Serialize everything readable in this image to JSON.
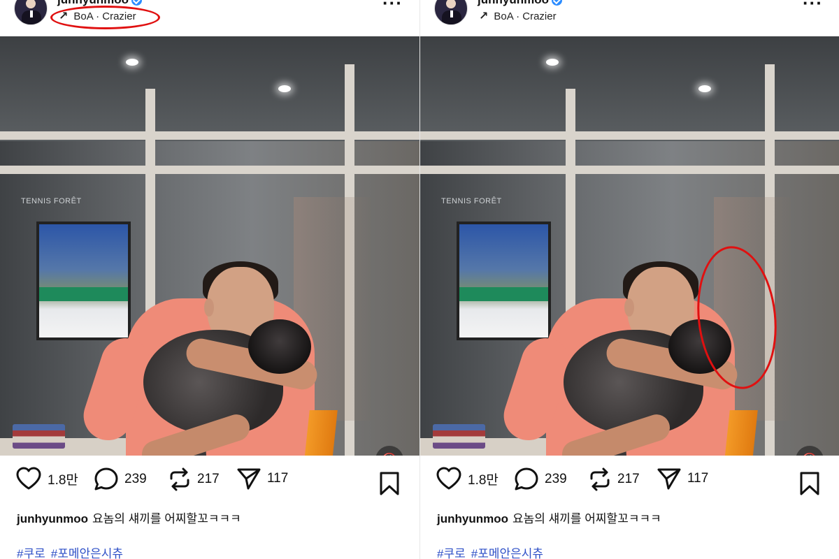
{
  "posts": [
    {
      "header": {
        "username": "junhyunmoo",
        "music": "BoA · Crazier",
        "more_icon": "more-horizontal-icon"
      },
      "stats": {
        "likes": "1.8만",
        "comments": "239",
        "reposts": "217",
        "shares": "117"
      },
      "caption": {
        "username": "junhyunmoo",
        "text": "요놈의 섀끼를 어찌할꼬ㅋㅋㅋ"
      },
      "hashtags": [
        "#쿠로",
        "#포메안은시츄"
      ],
      "photo": {
        "brand_text": "TENNIS FORÊT",
        "muted": true
      },
      "annotation": "music"
    },
    {
      "header": {
        "username": "junhyunmoo",
        "music": "BoA · Crazier",
        "more_icon": "more-horizontal-icon"
      },
      "stats": {
        "likes": "1.8만",
        "comments": "239",
        "reposts": "217",
        "shares": "117"
      },
      "caption": {
        "username": "junhyunmoo",
        "text": "요놈의 섀끼를 어찌할꼬ㅋㅋㅋ"
      },
      "hashtags": [
        "#쿠로",
        "#포메안은시츄"
      ],
      "photo": {
        "brand_text": "TENNIS FORÊT",
        "muted": true
      },
      "annotation": "reflection"
    }
  ],
  "colors": {
    "annotation": "#e01010",
    "verified": "#2b8cff",
    "hashtag": "#2e50c7",
    "shirt": "#ef8b78"
  }
}
